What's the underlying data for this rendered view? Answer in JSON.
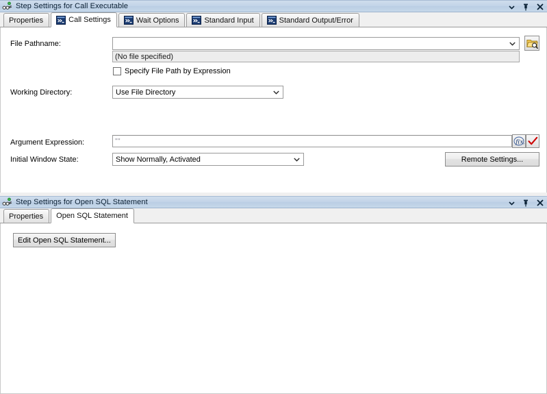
{
  "panels": [
    {
      "title": "Step Settings for Call Executable",
      "title_icon": "step-icon",
      "titlebar_buttons": [
        {
          "name": "panel-menu-button",
          "glyph": "▼"
        },
        {
          "name": "auto-hide-pin-button",
          "glyph": "⚐"
        },
        {
          "name": "close-button",
          "glyph": "✕"
        }
      ],
      "tabs": [
        {
          "label": "Properties",
          "active": false,
          "icon": null
        },
        {
          "label": "Call Settings",
          "active": true,
          "icon": "console-icon"
        },
        {
          "label": "Wait Options",
          "active": false,
          "icon": "console-icon"
        },
        {
          "label": "Standard Input",
          "active": false,
          "icon": "console-icon"
        },
        {
          "label": "Standard Output/Error",
          "active": false,
          "icon": "console-icon"
        }
      ],
      "form": {
        "file_pathname_label": "File Pathname:",
        "file_pathname_value": "",
        "file_pathname_placeholder": "",
        "file_status_value": "(No file specified)",
        "browse_button_icon": "folder-search-icon",
        "specify_by_expression_label": "Specify File Path by Expression",
        "specify_by_expression_checked": false,
        "working_directory_label": "Working Directory:",
        "working_directory_value": "Use File Directory",
        "argument_expression_label": "Argument Expression:",
        "argument_expression_value": "\"\"",
        "expression_button_icon": "function-fx-icon",
        "validate_button_icon": "red-check-icon",
        "initial_window_state_label": "Initial Window State:",
        "initial_window_state_value": "Show Normally, Activated",
        "remote_settings_label": "Remote Settings..."
      }
    },
    {
      "title": "Step Settings for Open SQL Statement",
      "title_icon": "step-icon",
      "titlebar_buttons": [
        {
          "name": "panel-menu-button",
          "glyph": "▼"
        },
        {
          "name": "auto-hide-pin-button",
          "glyph": "⚐"
        },
        {
          "name": "close-button",
          "glyph": "✕"
        }
      ],
      "tabs": [
        {
          "label": "Properties",
          "active": false,
          "icon": null
        },
        {
          "label": "Open SQL Statement",
          "active": true,
          "icon": null
        }
      ],
      "form": {
        "edit_statement_label": "Edit Open SQL Statement..."
      }
    }
  ],
  "colors": {
    "titlebar": "#c2d4e8",
    "tab_strip": "#f0f0f0",
    "field_border": "#9a9a9a",
    "readonly_field": "#ededed",
    "accent_red": "#cc0000",
    "console_icon_bg": "#1b3c72",
    "folder_yellow": "#f5cb54"
  }
}
